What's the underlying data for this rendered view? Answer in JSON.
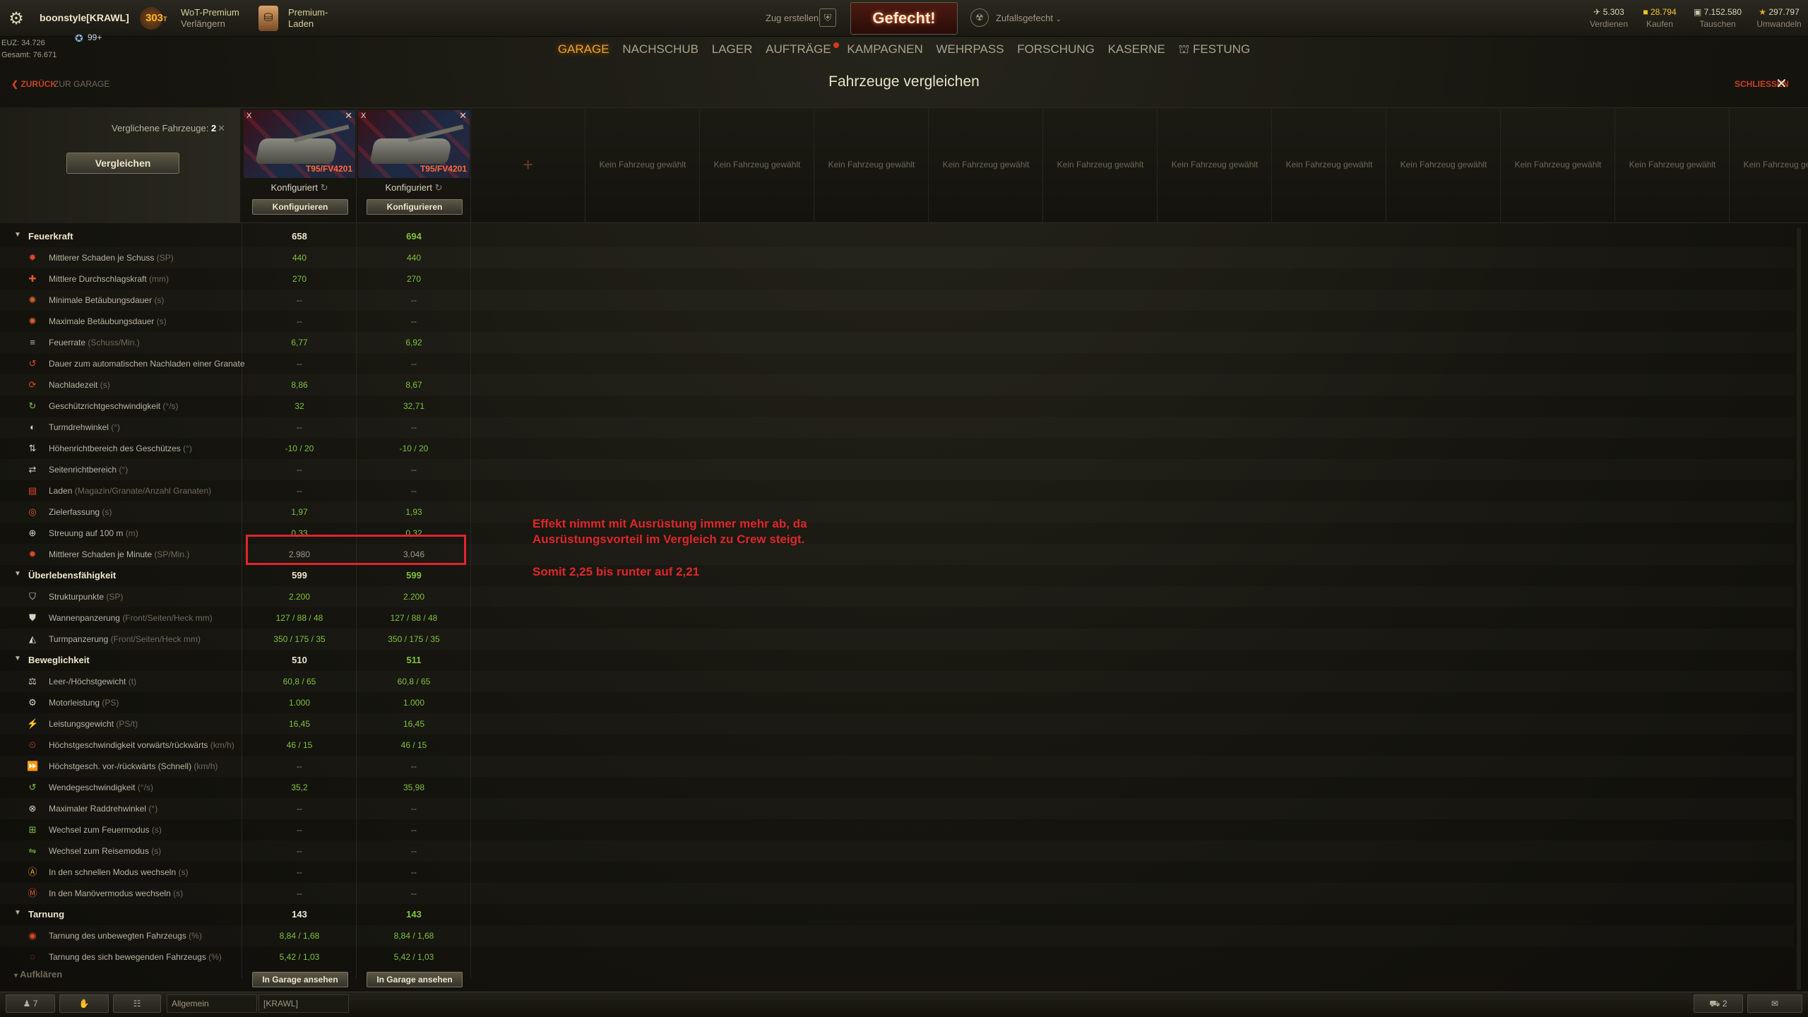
{
  "user": {
    "name": "boonstyle[KRAWL]",
    "level": "99+",
    "euz_label": "EUZ: 34.726",
    "gesamt_label": "Gesamt: 76.671"
  },
  "premium": {
    "days": "303",
    "days_unit": "T",
    "label1": "WoT-Premium",
    "label2": "Verlängern"
  },
  "shop": {
    "label1": "Premium-",
    "label2": "Laden"
  },
  "battle": {
    "zug_label": "Zug erstellen",
    "gefecht_label": "Gefecht!",
    "mode_label": "Zufallsgefecht"
  },
  "currencies": [
    {
      "value": "5.303",
      "label": "Verdienen",
      "color": "#d8d3bd"
    },
    {
      "value": "28.794",
      "label": "Kaufen",
      "color": "#ffc42c"
    },
    {
      "value": "7.152.580",
      "label": "Tauschen",
      "color": "#d8d3bd"
    },
    {
      "value": "297.797",
      "label": "Umwandeln",
      "color": "#e8a426"
    }
  ],
  "nav": [
    "GARAGE",
    "NACHSCHUB",
    "LAGER",
    "AUFTRÄGE",
    "KAMPAGNEN",
    "WEHRPASS",
    "FORSCHUNG",
    "KASERNE",
    "FESTUNG"
  ],
  "page": {
    "back_label": "ZURÜCK",
    "back_target": "ZUR GARAGE",
    "title": "Fahrzeuge vergleichen",
    "close_label": "SCHLIESSEN"
  },
  "compare": {
    "count_label": "Verglichene Fahrzeuge:",
    "count": "2",
    "compare_button": "Vergleichen",
    "empty_label": "Kein Fahrzeug gewählt"
  },
  "vehicles": [
    {
      "name": "T95/FV4201",
      "tier": "X",
      "status": "Konfiguriert",
      "config_button": "Konfigurieren",
      "garage_button": "In Garage ansehen"
    },
    {
      "name": "T95/FV4201",
      "tier": "X",
      "status": "Konfiguriert",
      "config_button": "Konfigurieren",
      "garage_button": "In Garage ansehen"
    }
  ],
  "rows": [
    {
      "type": "cat",
      "label": "Feuerkraft",
      "v1": "658",
      "v2": "694"
    },
    {
      "label": "Mittlerer Schaden je Schuss",
      "unit": "(SP)",
      "v1": "440",
      "v2": "440",
      "icon": "damage-icon",
      "icolor": "#e0472a"
    },
    {
      "label": "Mittlere Durchschlagskraft",
      "unit": "(mm)",
      "v1": "270",
      "v2": "270",
      "icon": "penetration-icon",
      "icolor": "#e05a2a"
    },
    {
      "label": "Minimale Betäubungsdauer",
      "unit": "(s)",
      "v1": "--",
      "v2": "--",
      "icon": "stun-min-icon",
      "icolor": "#d8662a"
    },
    {
      "label": "Maximale Betäubungsdauer",
      "unit": "(s)",
      "v1": "--",
      "v2": "--",
      "icon": "stun-max-icon",
      "icolor": "#d8662a"
    },
    {
      "label": "Feuerrate",
      "unit": "(Schuss/Min.)",
      "v1": "6,77",
      "v2": "6,92",
      "icon": "fire-rate-icon",
      "icolor": "#bbb39a"
    },
    {
      "label": "Dauer zum automatischen Nachladen einer Granate",
      "unit": "",
      "v1": "--",
      "v2": "--",
      "icon": "autoreload-icon",
      "icolor": "#e0472a"
    },
    {
      "label": "Nachladezeit",
      "unit": "(s)",
      "v1": "8,86",
      "v2": "8,67",
      "icon": "reload-icon",
      "icolor": "#e0472a"
    },
    {
      "label": "Geschützrichtgeschwindigkeit",
      "unit": "(°/s)",
      "v1": "32",
      "v2": "32,71",
      "icon": "traverse-icon",
      "icolor": "#7fc23a"
    },
    {
      "label": "Turmdrehwinkel",
      "unit": "(°)",
      "v1": "--",
      "v2": "--",
      "icon": "turret-icon",
      "icolor": "#d8d3bd"
    },
    {
      "label": "Höhenrichtbereich des Geschützes",
      "unit": "(°)",
      "v1": "-10 / 20",
      "v2": "-10 / 20",
      "icon": "elevation-icon",
      "icolor": "#d8d3bd"
    },
    {
      "label": "Seitenrichtbereich",
      "unit": "(°)",
      "v1": "--",
      "v2": "--",
      "icon": "horizontal-aim-icon",
      "icolor": "#d8d3bd"
    },
    {
      "label": "Laden",
      "unit": "(Magazin/Granate/Anzahl Granaten)",
      "v1": "--",
      "v2": "--",
      "icon": "magazine-icon",
      "icolor": "#e0472a"
    },
    {
      "label": "Zielerfassung",
      "unit": "(s)",
      "v1": "1,97",
      "v2": "1,93",
      "icon": "aim-time-icon",
      "icolor": "#e05a2a"
    },
    {
      "label": "Streuung auf 100 m",
      "unit": "(m)",
      "v1": "0,33",
      "v2": "0,32",
      "icon": "dispersion-icon",
      "icolor": "#d8d3bd"
    },
    {
      "label": "Mittlerer Schaden je Minute",
      "unit": "(SP/Min.)",
      "v1": "2.980",
      "v2": "3.046",
      "icon": "dpm-icon",
      "icolor": "#e0472a",
      "neutral": true
    },
    {
      "type": "cat",
      "label": "Überlebensfähigkeit",
      "v1": "599",
      "v2": "599"
    },
    {
      "label": "Strukturpunkte",
      "unit": "(SP)",
      "v1": "2.200",
      "v2": "2.200",
      "icon": "hitpoints-icon",
      "icolor": "#d8d3bd"
    },
    {
      "label": "Wannenpanzerung",
      "unit": "(Front/Seiten/Heck mm)",
      "v1": "127 / 88 / 48",
      "v2": "127 / 88 / 48",
      "icon": "hull-armor-icon",
      "icolor": "#d8d3bd"
    },
    {
      "label": "Turmpanzerung",
      "unit": "(Front/Seiten/Heck mm)",
      "v1": "350 / 175 / 35",
      "v2": "350 / 175 / 35",
      "icon": "turret-armor-icon",
      "icolor": "#d8d3bd"
    },
    {
      "type": "cat",
      "label": "Beweglichkeit",
      "v1": "510",
      "v2": "511"
    },
    {
      "label": "Leer-/Höchstgewicht",
      "unit": "(t)",
      "v1": "60,8 / 65",
      "v2": "60,8 / 65",
      "icon": "weight-icon",
      "icolor": "#d8d3bd"
    },
    {
      "label": "Motorleistung",
      "unit": "(PS)",
      "v1": "1.000",
      "v2": "1.000",
      "icon": "engine-icon",
      "icolor": "#d8d3bd"
    },
    {
      "label": "Leistungsgewicht",
      "unit": "(PS/t)",
      "v1": "16,45",
      "v2": "16,45",
      "icon": "power-ratio-icon",
      "icolor": "#d8d3bd"
    },
    {
      "label": "Höchstgeschwindigkeit vorwärts/rückwärts",
      "unit": "(km/h)",
      "v1": "46 / 15",
      "v2": "46 / 15",
      "icon": "speed-icon",
      "icolor": "#e0472a"
    },
    {
      "label": "Höchstgesch. vor-/rückwärts (Schnell)",
      "unit": "(km/h)",
      "v1": "--",
      "v2": "--",
      "icon": "speed-fast-icon",
      "icolor": "#e0472a"
    },
    {
      "label": "Wendegeschwindigkeit",
      "unit": "(°/s)",
      "v1": "35,2",
      "v2": "35,98",
      "icon": "hull-traverse-icon",
      "icolor": "#7fc23a"
    },
    {
      "label": "Maximaler Raddrehwinkel",
      "unit": "(°)",
      "v1": "--",
      "v2": "--",
      "icon": "wheel-angle-icon",
      "icolor": "#d8d3bd"
    },
    {
      "label": "Wechsel zum Feuermodus",
      "unit": "(s)",
      "v1": "--",
      "v2": "--",
      "icon": "siege-mode-icon",
      "icolor": "#7fc23a"
    },
    {
      "label": "Wechsel zum Reisemodus",
      "unit": "(s)",
      "v1": "--",
      "v2": "--",
      "icon": "travel-mode-icon",
      "icolor": "#7fc23a"
    },
    {
      "label": "In den schnellen Modus wechseln",
      "unit": "(s)",
      "v1": "--",
      "v2": "--",
      "icon": "fast-mode-icon",
      "icolor": "#e8a426"
    },
    {
      "label": "In den Manövermodus wechseln",
      "unit": "(s)",
      "v1": "--",
      "v2": "--",
      "icon": "maneuver-mode-icon",
      "icolor": "#e05a2a"
    },
    {
      "type": "cat",
      "label": "Tarnung",
      "v1": "143",
      "v2": "143"
    },
    {
      "label": "Tarnung des unbewegten Fahrzeugs",
      "unit": "(%)",
      "v1": "8,84 / 1,68",
      "v2": "8,84 / 1,68",
      "icon": "camo-static-icon",
      "icolor": "#e0472a",
      "whitelabel": true
    },
    {
      "label": "Tarnung des sich bewegenden Fahrzeugs",
      "unit": "(%)",
      "v1": "5,42 / 1,03",
      "v2": "5,42 / 1,03",
      "icon": "camo-moving-icon",
      "icolor": "#e0472a",
      "whitelabel": true
    }
  ],
  "aufklaeren_label": "Aufklären",
  "annotation": {
    "line1": "Effekt nimmt mit Ausrüstung immer mehr ab, da",
    "line2": "Ausrüstungsvorteil im Vergleich zu Crew steigt.",
    "line3": "Somit 2,25 bis runter auf 2,21"
  },
  "bottom": {
    "players": "7",
    "chat_channel": "Allgemein",
    "chat_clan": "[KRAWL]",
    "notif_count": "2"
  }
}
